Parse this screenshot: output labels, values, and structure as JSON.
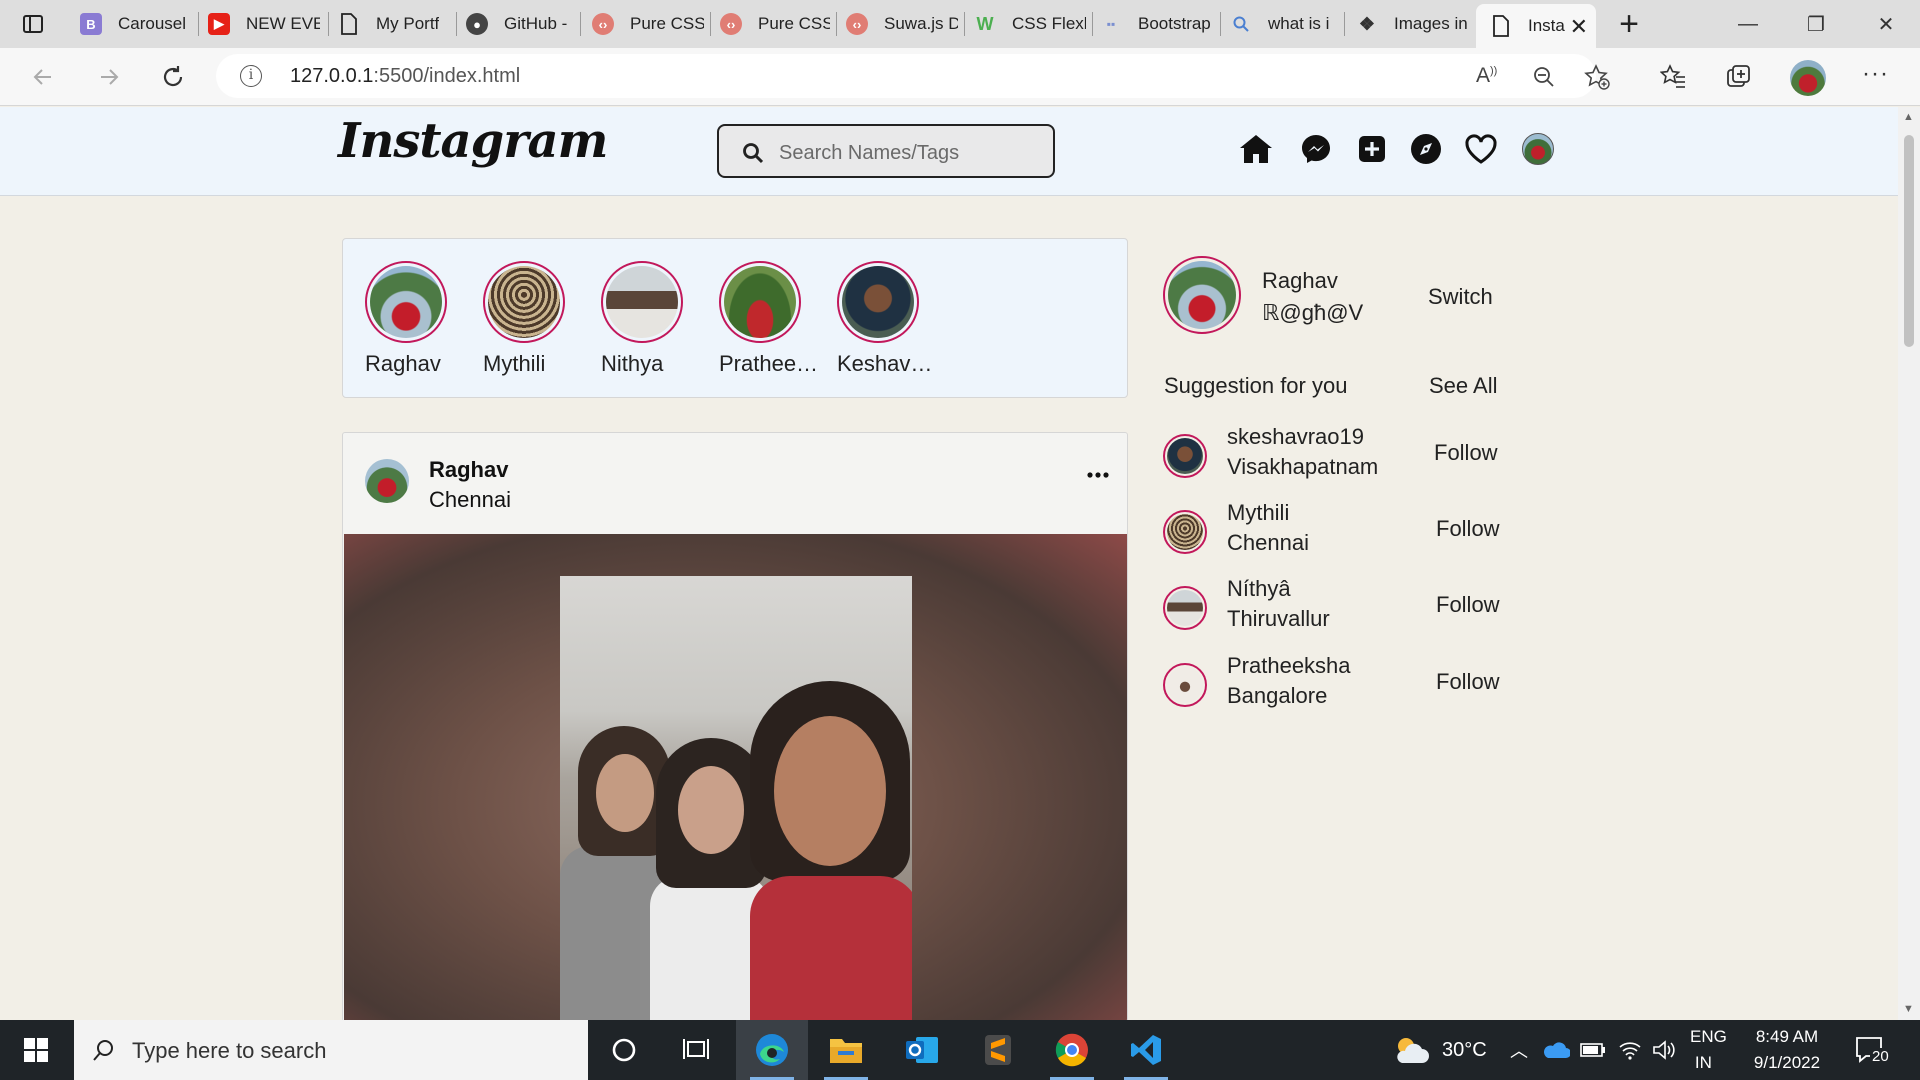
{
  "browser": {
    "tabs": [
      {
        "title": "Carousel",
        "icon": "bootstrap-icon"
      },
      {
        "title": "NEW EVE",
        "icon": "youtube-icon"
      },
      {
        "title": "My Portf",
        "icon": "page-icon"
      },
      {
        "title": "GitHub -",
        "icon": "github-icon"
      },
      {
        "title": "Pure CSS",
        "icon": "code-icon"
      },
      {
        "title": "Pure CSS",
        "icon": "code-icon"
      },
      {
        "title": "Suwa.js D",
        "icon": "code-icon"
      },
      {
        "title": "CSS Flexb",
        "icon": "w3schools-icon"
      },
      {
        "title": "Bootstrap",
        "icon": "bootstrap-cdn-icon"
      },
      {
        "title": "what is i",
        "icon": "search-icon"
      },
      {
        "title": "Images in",
        "icon": "codepen-icon"
      },
      {
        "title": "Insta",
        "icon": "page-icon"
      }
    ],
    "url_host": "127.0.0.1",
    "url_path": ":5500/index.html"
  },
  "header": {
    "logo": "Instagram",
    "search_placeholder": "Search Names/Tags"
  },
  "stories": [
    {
      "name": "Raghav"
    },
    {
      "name": "Mythili"
    },
    {
      "name": "Nithya"
    },
    {
      "name": "Prathee…"
    },
    {
      "name": "Keshav …"
    }
  ],
  "post": {
    "name": "Raghav",
    "location": "Chennai"
  },
  "sidebar": {
    "me_name": "Raghav",
    "me_handle": "ℝ@gћ@V",
    "switch_label": "Switch",
    "suggestion_heading": "Suggestion for you",
    "see_all": "See All",
    "suggestions": [
      {
        "name": "skeshavrao19",
        "location": "Visakhapatnam",
        "action": "Follow"
      },
      {
        "name": "Mythili",
        "location": "Chennai",
        "action": "Follow"
      },
      {
        "name": "Níthyâ",
        "location": "Thiruvallur",
        "action": "Follow"
      },
      {
        "name": "Pratheeksha",
        "location": "Bangalore",
        "action": "Follow"
      }
    ]
  },
  "taskbar": {
    "search_placeholder": "Type here to search",
    "weather": "30°C",
    "lang": "ENG",
    "region": "IN",
    "time": "8:49 AM",
    "date": "9/1/2022",
    "notifications": "20"
  },
  "colors": {
    "story_ring": "#c2185b",
    "header_bg": "#eef5fc",
    "page_bg": "#f2efe7"
  }
}
